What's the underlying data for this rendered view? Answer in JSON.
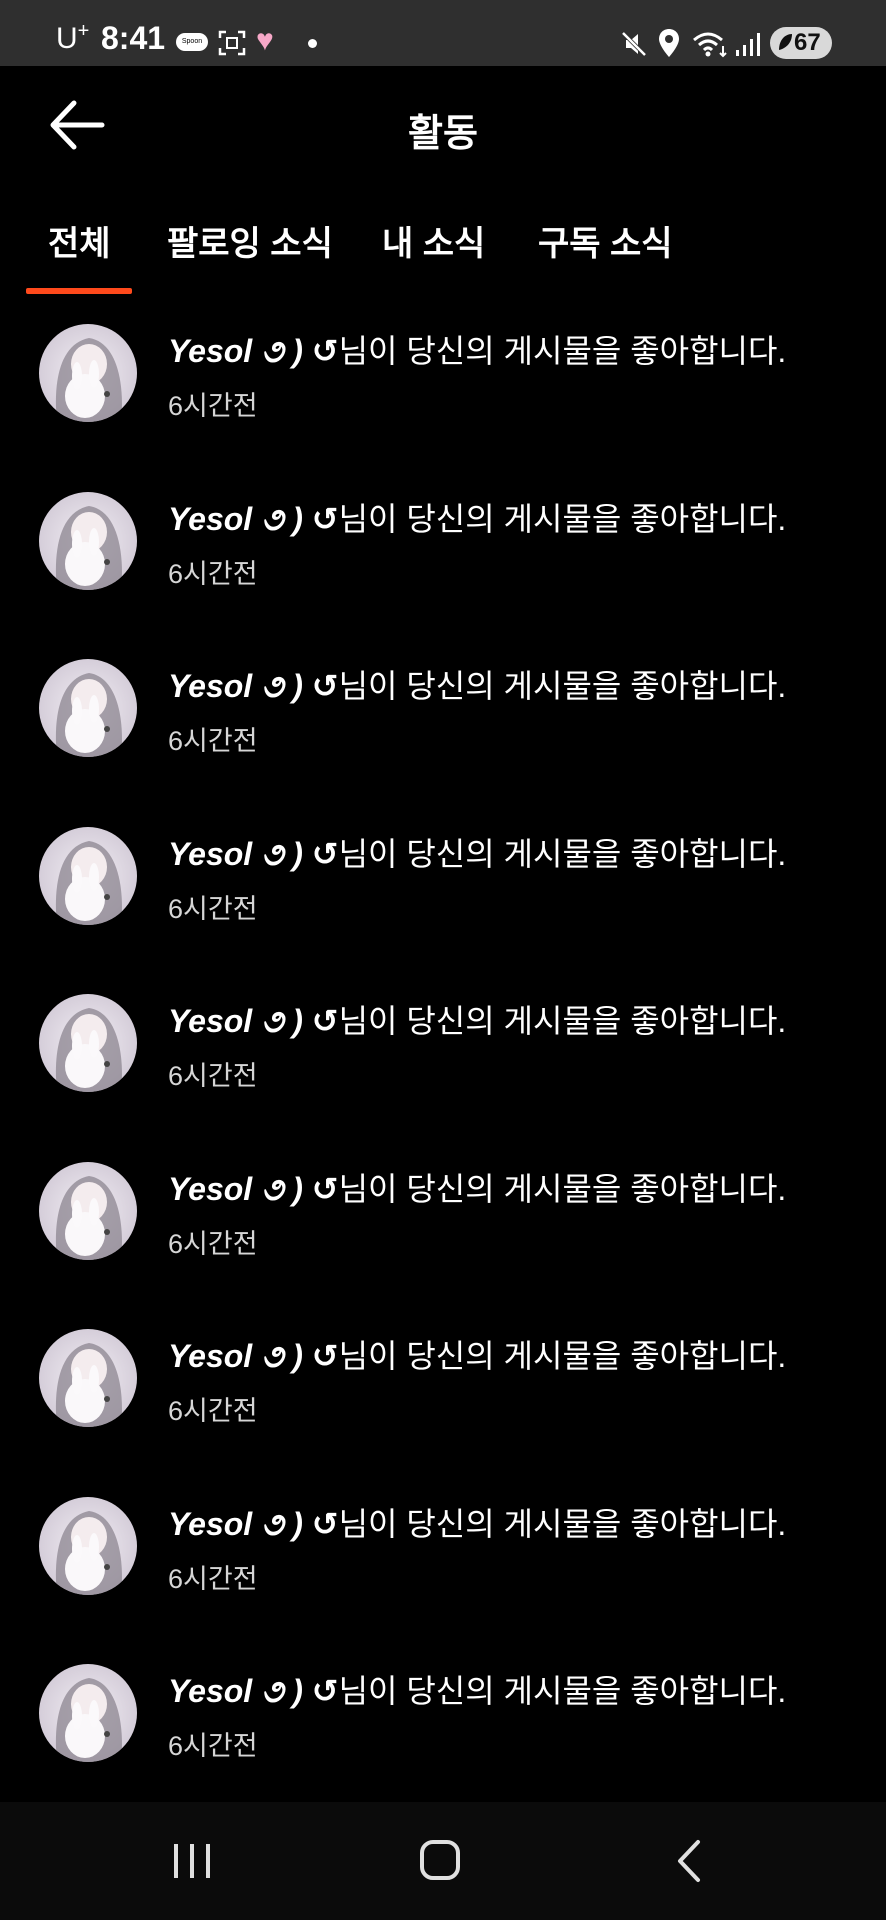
{
  "status_bar": {
    "carrier": "U",
    "carrier_sup": "+",
    "time": "8:41",
    "spoon_badge": "Spoon",
    "battery": "67",
    "icons": [
      "spoon-icon",
      "screenshot-icon",
      "heart-icon",
      "dot-icon",
      "mute-icon",
      "location-icon",
      "wifi-icon",
      "signal-icon",
      "battery-icon"
    ]
  },
  "header": {
    "title": "활동",
    "back_icon": "arrow-left-icon"
  },
  "tabs": [
    {
      "label": "전체",
      "selected": true
    },
    {
      "label": "팔로잉 소식",
      "selected": false
    },
    {
      "label": "내 소식",
      "selected": false
    },
    {
      "label": "구독 소식",
      "selected": false
    }
  ],
  "accent_color": "#ff4a1c",
  "activities": [
    {
      "user": "Yesol ૭ ) ↺",
      "message": "님이 당신의 게시물을 좋아합니다.",
      "time": "6시간전"
    },
    {
      "user": "Yesol ૭ ) ↺",
      "message": "님이 당신의 게시물을 좋아합니다.",
      "time": "6시간전"
    },
    {
      "user": "Yesol ૭ ) ↺",
      "message": "님이 당신의 게시물을 좋아합니다.",
      "time": "6시간전"
    },
    {
      "user": "Yesol ૭ ) ↺",
      "message": "님이 당신의 게시물을 좋아합니다.",
      "time": "6시간전"
    },
    {
      "user": "Yesol ૭ ) ↺",
      "message": "님이 당신의 게시물을 좋아합니다.",
      "time": "6시간전"
    },
    {
      "user": "Yesol ૭ ) ↺",
      "message": "님이 당신의 게시물을 좋아합니다.",
      "time": "6시간전"
    },
    {
      "user": "Yesol ૭ ) ↺",
      "message": "님이 당신의 게시물을 좋아합니다.",
      "time": "6시간전"
    },
    {
      "user": "Yesol ૭ ) ↺",
      "message": "님이 당신의 게시물을 좋아합니다.",
      "time": "6시간전"
    },
    {
      "user": "Yesol ૭ ) ↺",
      "message": "님이 당신의 게시물을 좋아합니다.",
      "time": "6시간전"
    }
  ],
  "nav_bar": {
    "icons": [
      "recent-apps-icon",
      "home-icon",
      "back-icon"
    ]
  }
}
